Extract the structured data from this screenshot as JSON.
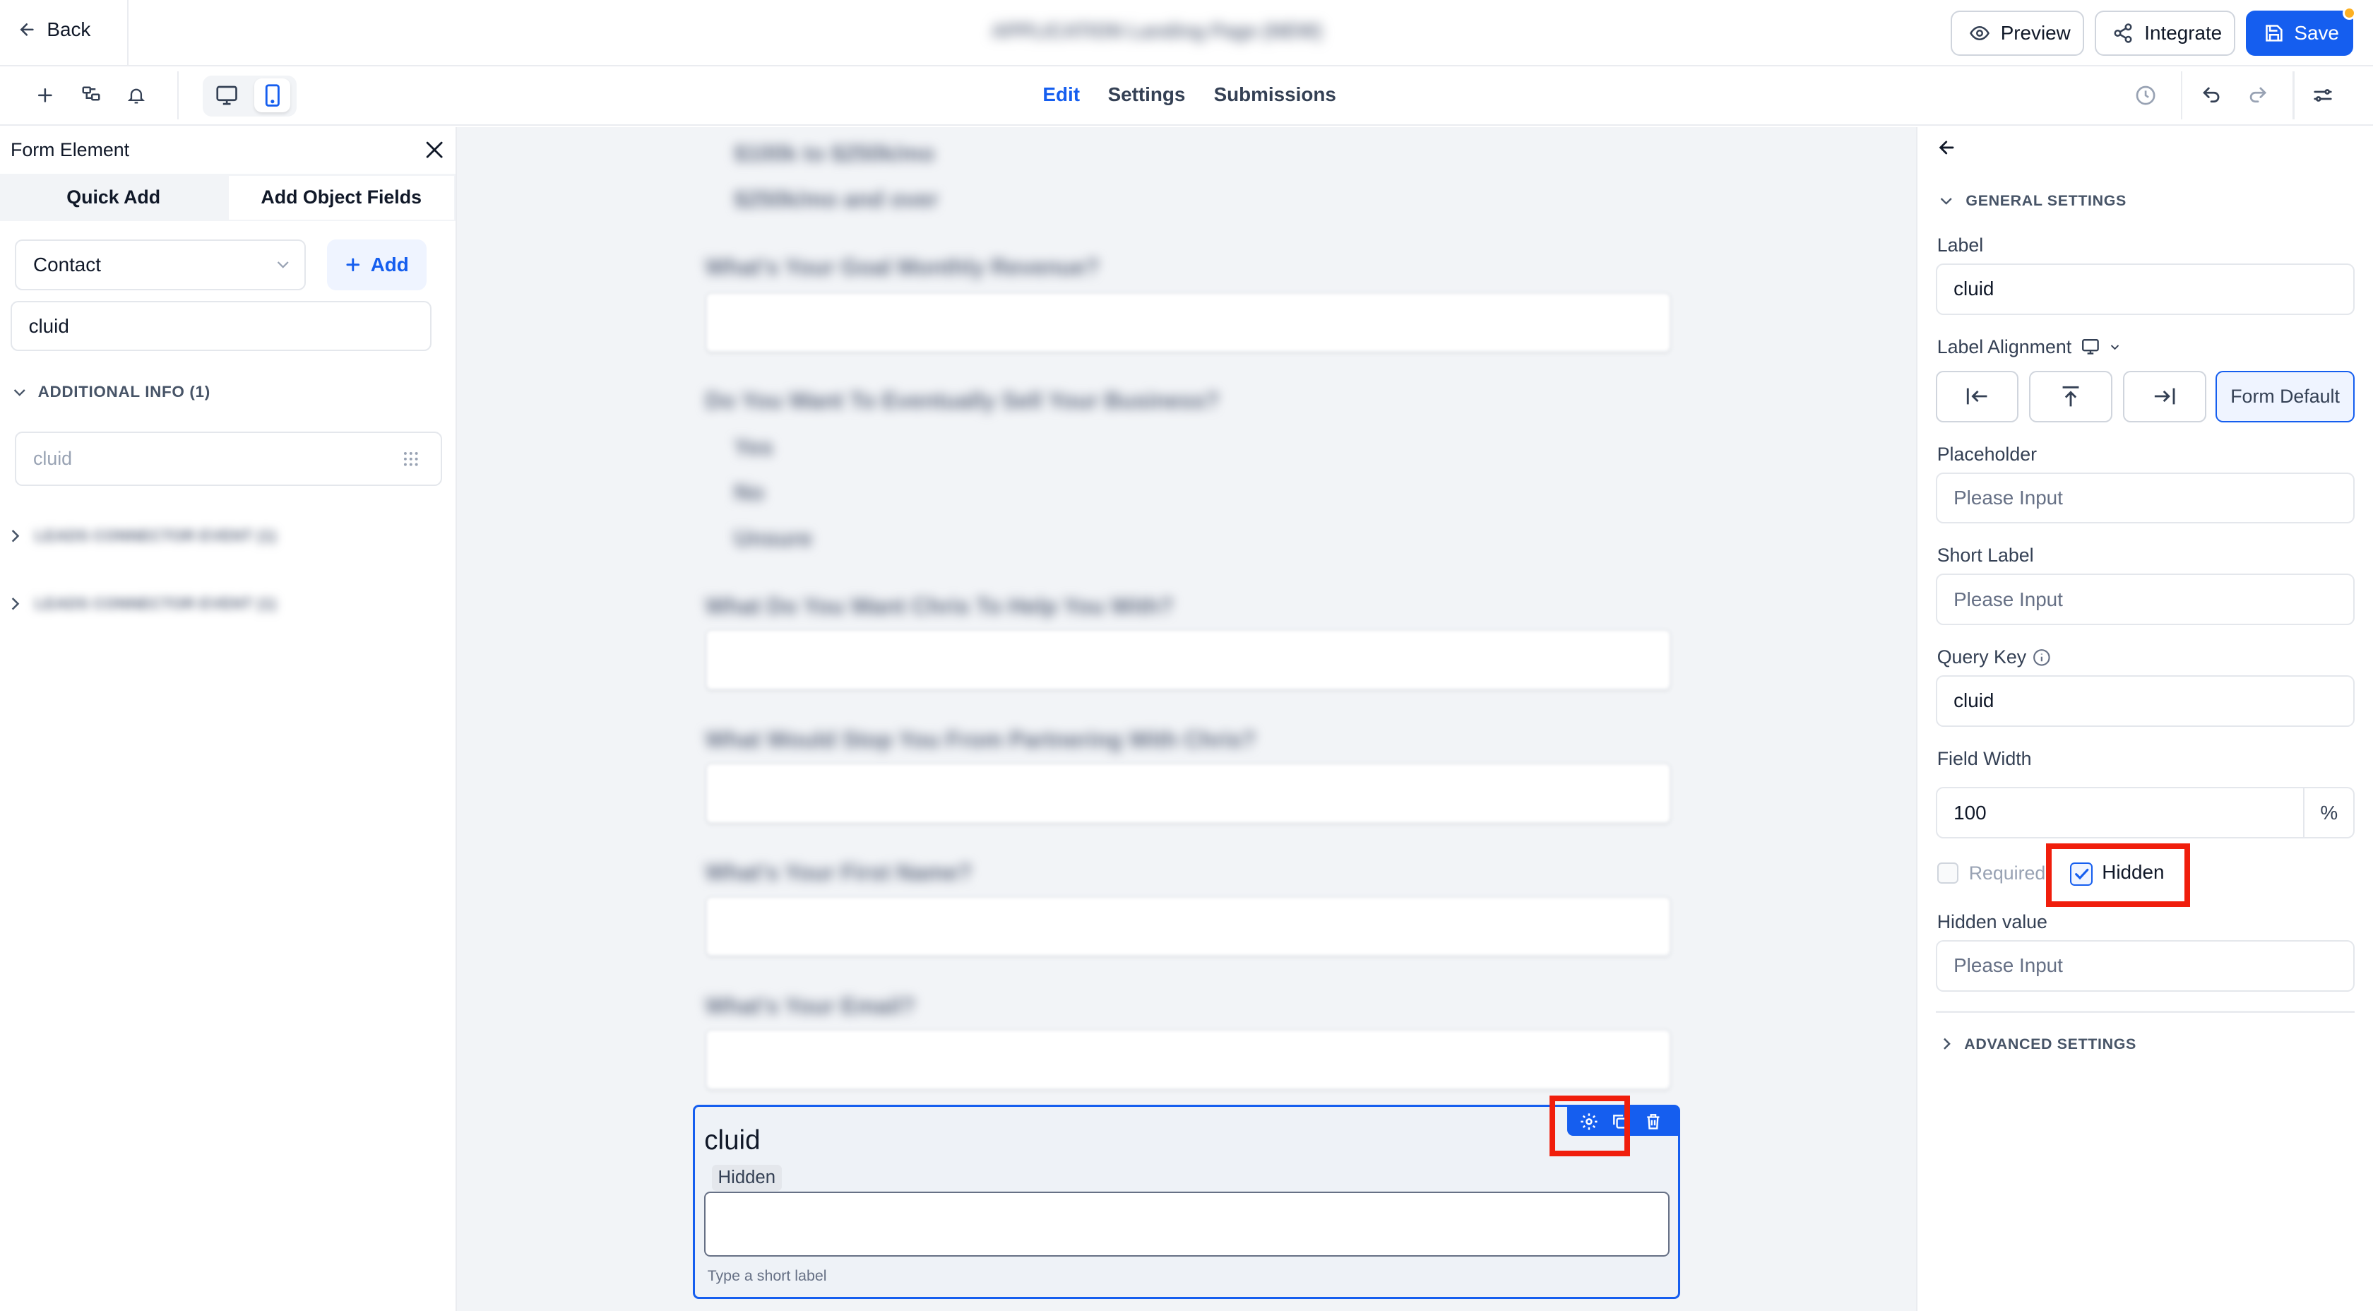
{
  "header": {
    "back_label": "Back",
    "title": "APPLICATION Landing Page (NEW)",
    "preview_label": "Preview",
    "integrate_label": "Integrate",
    "save_label": "Save"
  },
  "nav": {
    "tabs": [
      {
        "label": "Edit"
      },
      {
        "label": "Settings"
      },
      {
        "label": "Submissions"
      }
    ],
    "active_tab": "Edit"
  },
  "left_panel": {
    "title": "Form Element",
    "tabs": [
      {
        "label": "Quick Add"
      },
      {
        "label": "Add Object Fields"
      }
    ],
    "object_select": "Contact",
    "add_label": "Add",
    "search_value": "cluid",
    "group_label": "ADDITIONAL INFO (1)",
    "field_item": "cluid",
    "collapsed_groups": [
      {
        "label": "LEADS CONNECTOR EVENT (1)"
      },
      {
        "label": "LEADS CONNECTOR EVENT (1)"
      }
    ]
  },
  "canvas": {
    "blurred_options_top": [
      "$100k to $250k/mo",
      "$250k/mo and over"
    ],
    "q_revenue": "What's Your Goal Monthly Revenue?",
    "q_sell": "Do You Want To Eventually Sell Your Business?",
    "sell_options": [
      "Yes",
      "No",
      "Unsure"
    ],
    "q_help": "What Do You Want Chris To Help You With?",
    "q_stop": "What Would Stop You From Partnering With Chris?",
    "q_first": "What's Your First Name?",
    "q_email": "What's Your Email?",
    "selected_field": {
      "label": "cluid",
      "badge": "Hidden",
      "helper": "Type a short label"
    }
  },
  "right_panel": {
    "section_general": "GENERAL SETTINGS",
    "label_title": "Label",
    "label_value": "cluid",
    "alignment_title": "Label Alignment",
    "alignment_default": "Form Default",
    "placeholder_title": "Placeholder",
    "placeholder_ph": "Please Input",
    "short_label_title": "Short Label",
    "short_label_ph": "Please Input",
    "query_key_title": "Query Key",
    "query_key_value": "cluid",
    "field_width_title": "Field Width",
    "field_width_value": "100",
    "field_width_unit": "%",
    "required_label": "Required",
    "hidden_label": "Hidden",
    "hidden_checked": true,
    "hidden_value_title": "Hidden value",
    "hidden_value_ph": "Please Input",
    "section_advanced": "ADVANCED SETTINGS"
  },
  "colors": {
    "primary": "#155eef",
    "highlight": "#f01e0c",
    "canvas_bg": "#f2f4f7"
  }
}
